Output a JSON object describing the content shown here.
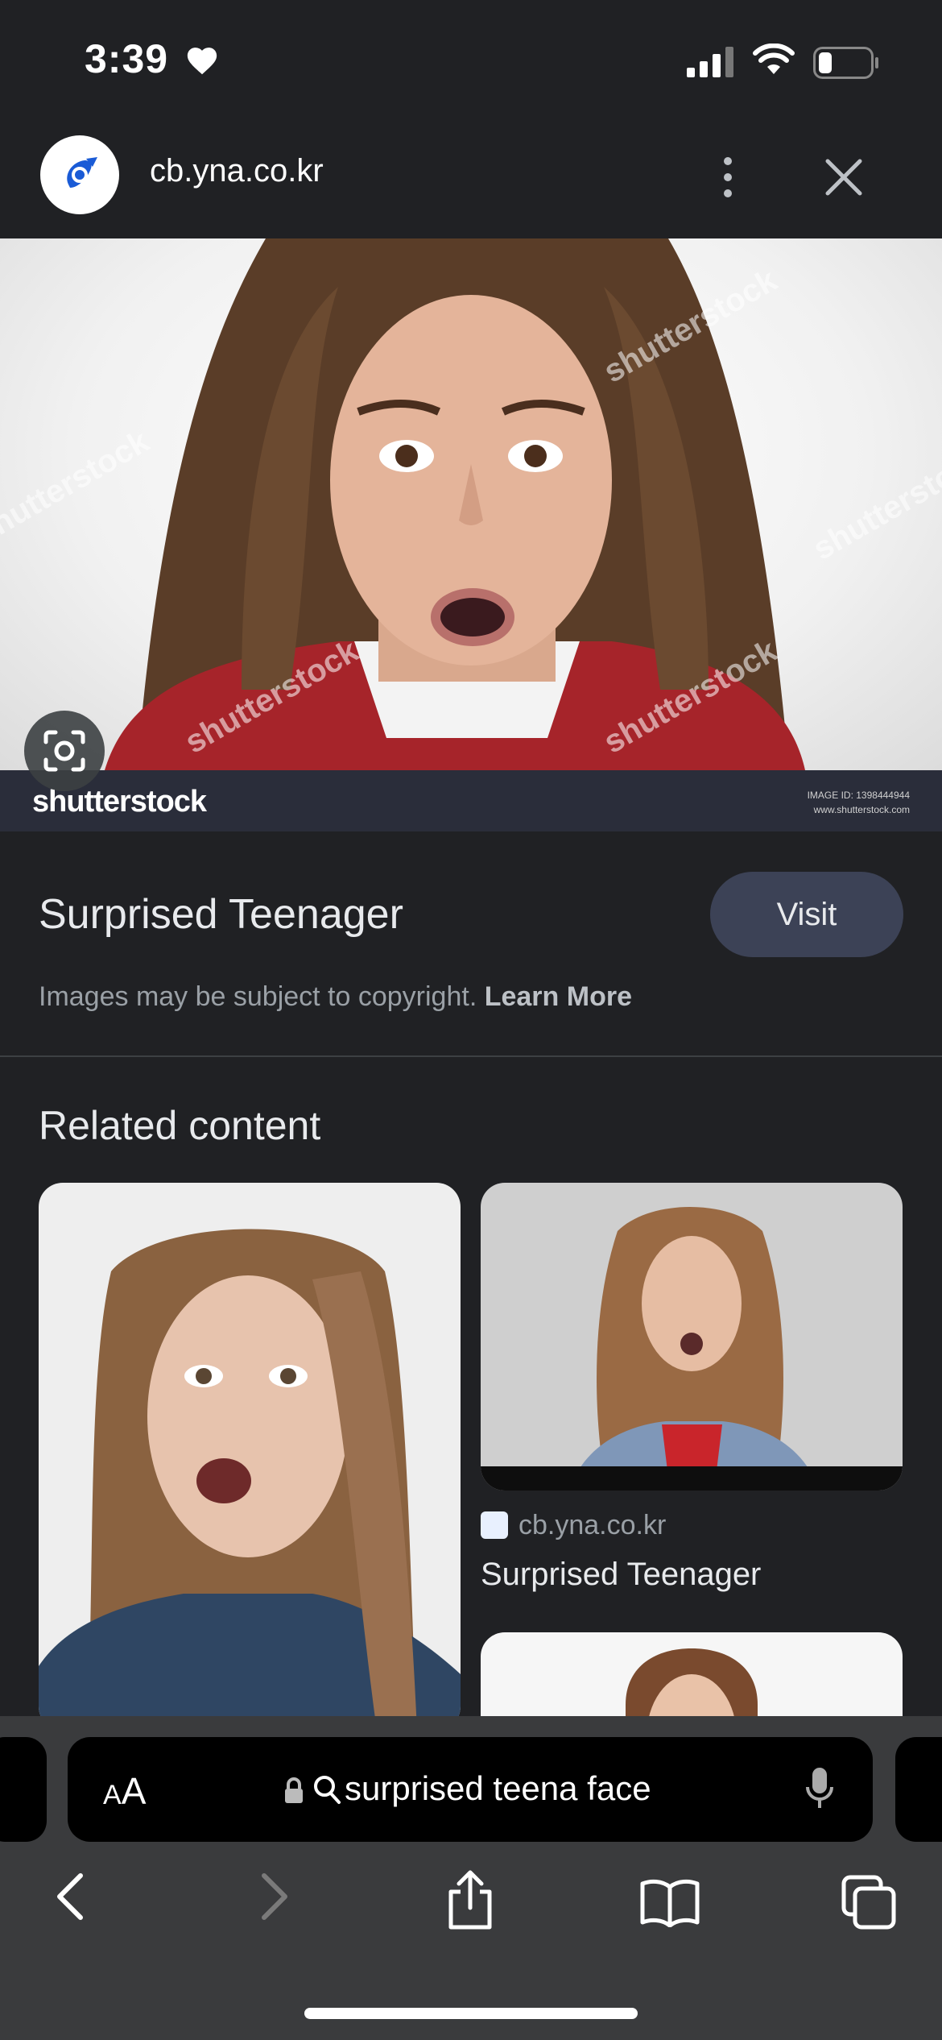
{
  "status_bar": {
    "time": "3:39"
  },
  "header": {
    "url": "cb.yna.co.kr"
  },
  "hero": {
    "brand": "shutterstock",
    "image_id_label": "IMAGE ID:",
    "image_id": "1398444944",
    "site": "www.shutterstock.com"
  },
  "result": {
    "title": "Surprised Teenager",
    "visit_label": "Visit",
    "copyright_text": "Images may be subject to copyright.",
    "learn_more": "Learn More"
  },
  "related": {
    "heading": "Related content",
    "items": [
      {
        "source": "cb.yna.co.kr",
        "title": "Surprised Teenager"
      }
    ]
  },
  "browser": {
    "text_size_label_small": "A",
    "text_size_label_large": "A",
    "query": "surprised teena face"
  },
  "colors": {
    "background": "#202124",
    "visit_button": "#3c4256",
    "chrome": "#3a3b3d"
  }
}
